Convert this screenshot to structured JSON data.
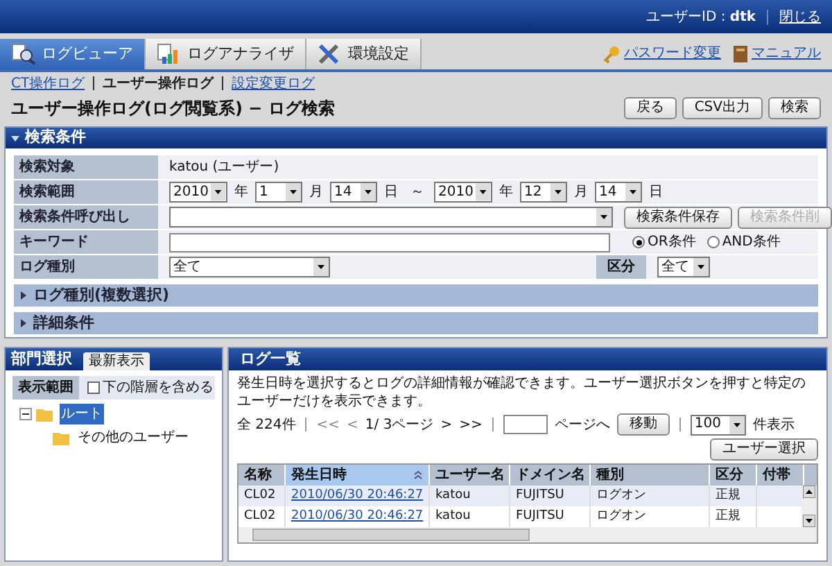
{
  "header": {
    "user_label": "ユーザーID : ",
    "user_id": "dtk",
    "close": "閉じる"
  },
  "tabs": [
    {
      "label": "ログビューア",
      "selected": true
    },
    {
      "label": "ログアナライザ",
      "selected": false
    },
    {
      "label": "環境設定",
      "selected": false
    }
  ],
  "header_links": [
    {
      "label": "パスワード変更"
    },
    {
      "label": "マニュアル"
    }
  ],
  "sub_nav": [
    {
      "label": "CT操作ログ",
      "selected": false
    },
    {
      "label": "ユーザー操作ログ",
      "selected": true
    },
    {
      "label": "設定変更ログ",
      "selected": false
    }
  ],
  "page_title": "ユーザー操作ログ(ログ閲覧系) − ログ検索",
  "page_buttons": [
    "戻る",
    "CSV出力",
    "検索"
  ],
  "search": {
    "title": "検索条件",
    "target_label": "検索対象",
    "target_value": "katou (ユーザー)",
    "range_label": "検索範囲",
    "range": [
      {
        "value": "2010",
        "unit": "年"
      },
      {
        "value": "1",
        "unit": "月"
      },
      {
        "value": "14",
        "unit": "日"
      },
      {
        "value": "2010",
        "unit": "年"
      },
      {
        "value": "12",
        "unit": "月"
      },
      {
        "value": "14",
        "unit": "日"
      }
    ],
    "range_sep": "～",
    "recall_label": "検索条件呼び出し",
    "save_button": "検索条件保存",
    "delete_button": {
      "label": "検索条件削",
      "disabled": true
    },
    "keyword_label": "キーワード",
    "conditions": [
      {
        "label": "OR条件",
        "selected": true
      },
      {
        "label": "AND条件",
        "selected": false
      }
    ],
    "log_type_label": "ログ種別",
    "log_type_value": "全て",
    "category_label": "区分",
    "category_value": "全て",
    "sections": [
      {
        "label": "ログ種別(複数選択)",
        "expanded": false
      },
      {
        "label": "詳細条件",
        "expanded": false
      }
    ]
  },
  "department": {
    "title": "部門選択",
    "refresh": "最新表示",
    "scope_label": "表示範囲",
    "include_sub": {
      "label": "下の階層を含める",
      "checked": false
    },
    "tree": [
      {
        "label": "ルート",
        "selected": true,
        "expanded": true,
        "children": [
          {
            "label": "その他のユーザー",
            "selected": false
          }
        ]
      }
    ]
  },
  "log_list": {
    "title": "ログ一覧",
    "description": "発生日時を選択するとログの詳細情報が確認できます。ユーザー選択ボタンを押すと特定のユーザーだけを表示できます。",
    "total": "全 224件",
    "first": "<<",
    "prev": "<",
    "page": "1/ 3ページ",
    "next": ">",
    "last": ">>",
    "goto_suffix": "ページへ",
    "move_button": "移動",
    "per_page": "100",
    "per_page_suffix": "件表示",
    "user_select_button": "ユーザー選択",
    "columns": [
      {
        "label": "名称",
        "sorted": false
      },
      {
        "label": "発生日時",
        "sorted": true
      },
      {
        "label": "ユーザー名",
        "sorted": false
      },
      {
        "label": "ドメイン名",
        "sorted": false
      },
      {
        "label": "種別",
        "sorted": false
      },
      {
        "label": "区分",
        "sorted": false
      },
      {
        "label": "付帯",
        "sorted": false
      }
    ],
    "rows": [
      [
        "CL02",
        "2010/06/30 20:46:27",
        "katou",
        "FUJITSU",
        "ログオン",
        "正規"
      ],
      [
        "CL02",
        "2010/06/30 20:46:27",
        "katou",
        "FUJITSU",
        "ログオン",
        "正規"
      ]
    ]
  }
}
